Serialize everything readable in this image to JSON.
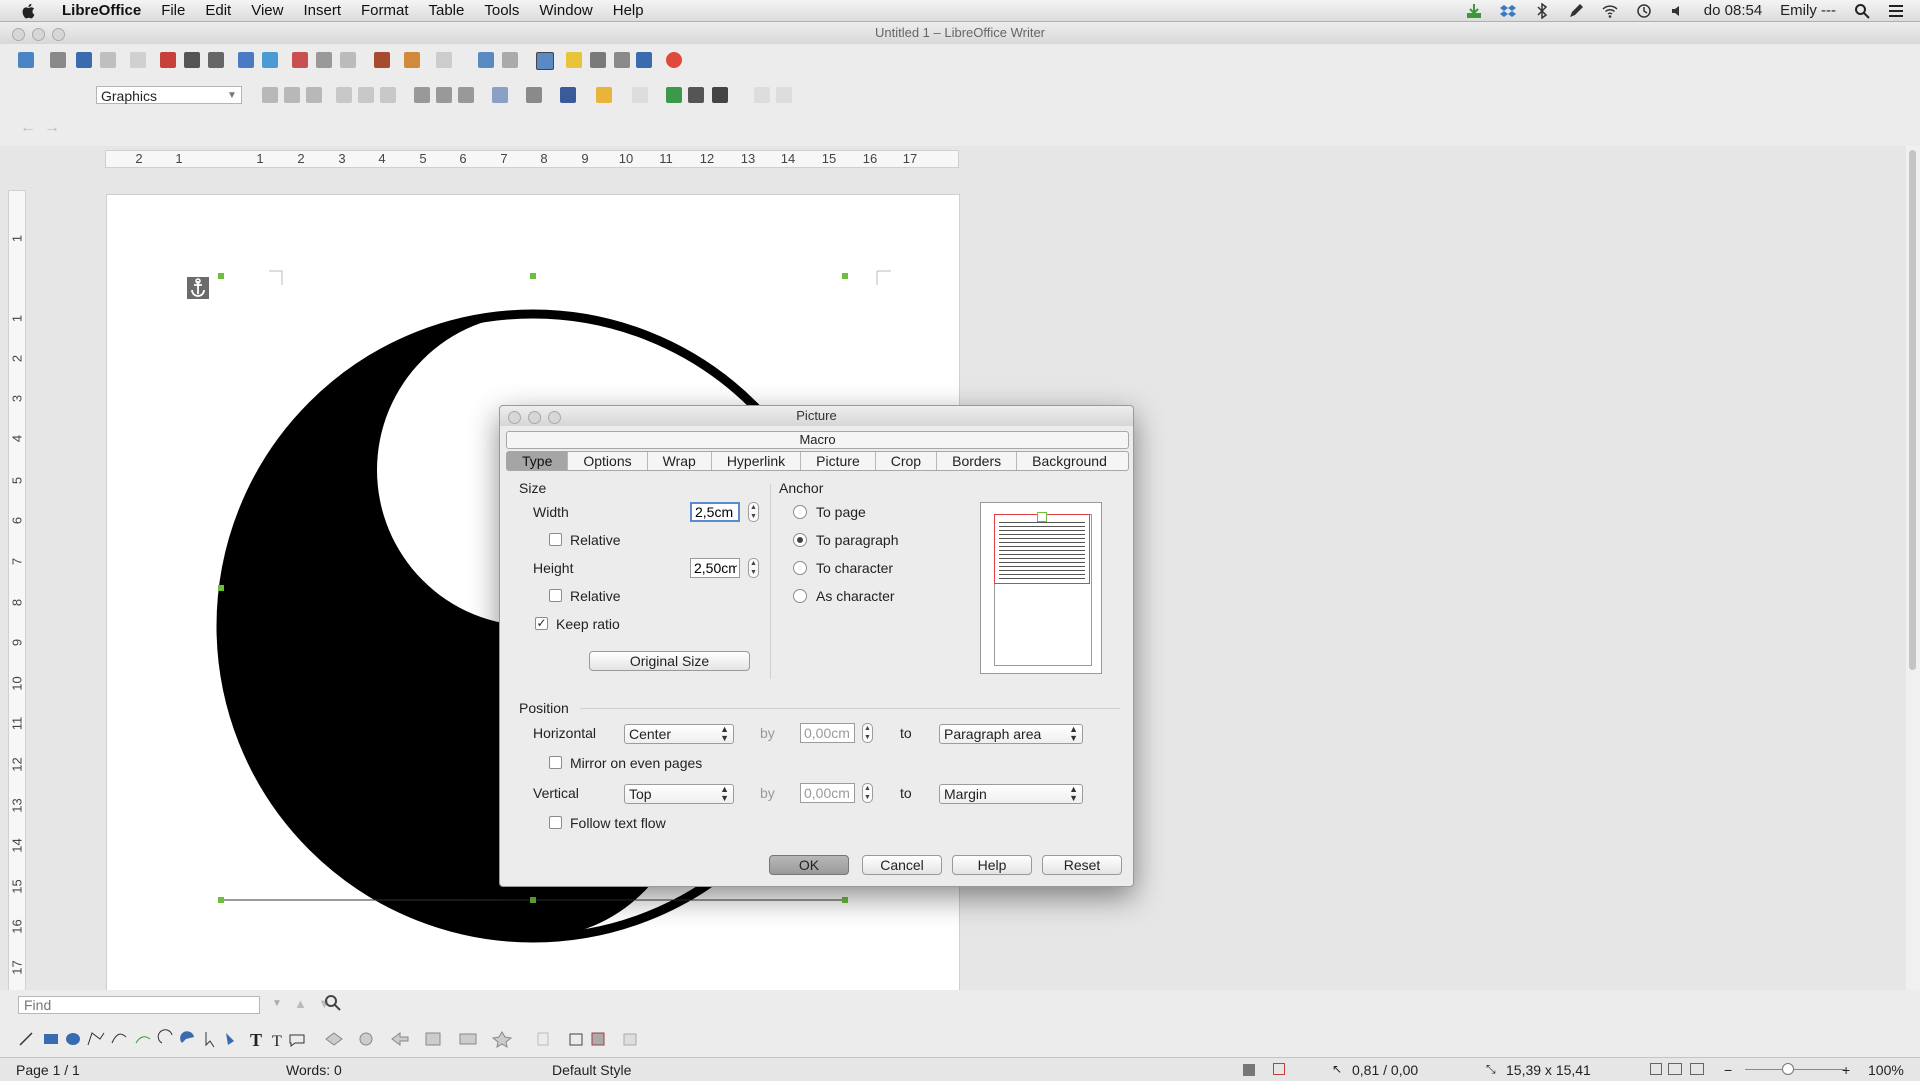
{
  "menubar": {
    "app_name": "LibreOffice",
    "items": [
      "File",
      "Edit",
      "View",
      "Insert",
      "Format",
      "Table",
      "Tools",
      "Window",
      "Help"
    ],
    "clock": "do 08:54",
    "user": "Emily ---"
  },
  "window": {
    "title": "Untitled 1 – LibreOffice Writer"
  },
  "toolbar2": {
    "style_value": "Graphics"
  },
  "ruler": {
    "h_ticks": [
      "2",
      "1",
      "1",
      "2",
      "3",
      "4",
      "5",
      "6",
      "7",
      "8",
      "9",
      "10",
      "11",
      "12",
      "13",
      "14",
      "15",
      "16",
      "17"
    ],
    "v_ticks": [
      "1",
      "1",
      "2",
      "3",
      "4",
      "5",
      "6",
      "7",
      "8",
      "9",
      "10",
      "11",
      "12",
      "13",
      "14",
      "15",
      "16",
      "17"
    ]
  },
  "dialog": {
    "title": "Picture",
    "macro_label": "Macro",
    "tabs": [
      "Type",
      "Options",
      "Wrap",
      "Hyperlink",
      "Picture",
      "Crop",
      "Borders",
      "Background"
    ],
    "active_tab": "Type",
    "size": {
      "section": "Size",
      "width_label": "Width",
      "width_value": "2,5cm",
      "width_relative": "Relative",
      "height_label": "Height",
      "height_value": "2,50cm",
      "height_relative": "Relative",
      "keep_ratio": "Keep ratio",
      "original_size": "Original Size"
    },
    "anchor": {
      "section": "Anchor",
      "to_page": "To page",
      "to_paragraph": "To paragraph",
      "to_character": "To character",
      "as_character": "As character",
      "selected": "To paragraph"
    },
    "position": {
      "section": "Position",
      "horizontal_label": "Horizontal",
      "horizontal_value": "Center",
      "by_label": "by",
      "horizontal_by": "0,00cm",
      "to_label": "to",
      "horizontal_to": "Paragraph area",
      "mirror": "Mirror on even pages",
      "vertical_label": "Vertical",
      "vertical_value": "Top",
      "vertical_by": "0,00cm",
      "vertical_to": "Margin",
      "follow": "Follow text flow"
    },
    "buttons": {
      "ok": "OK",
      "cancel": "Cancel",
      "help": "Help",
      "reset": "Reset"
    }
  },
  "findbar": {
    "placeholder": "Find"
  },
  "statusbar": {
    "page": "Page 1 / 1",
    "words": "Words: 0",
    "style": "Default Style",
    "position": "0,81 / 0,00",
    "size": "15,39 x 15,41",
    "zoom": "100%"
  },
  "colors": {
    "selection_handle": "#6cbf3a",
    "accent": "#3a78c8"
  }
}
